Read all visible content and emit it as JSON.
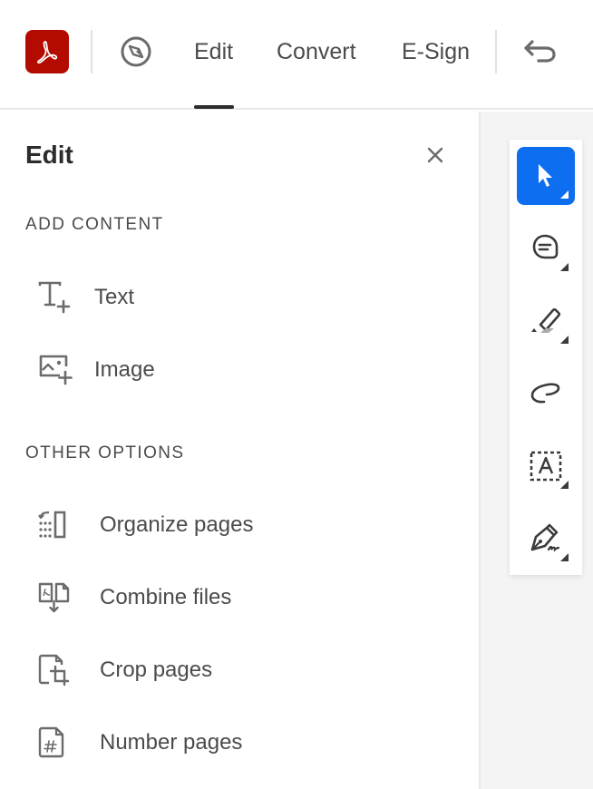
{
  "header": {
    "app_logo": "adobe-acrobat-logo",
    "nav_icon": "compass-icon",
    "tabs": [
      {
        "label": "Edit",
        "selected": true
      },
      {
        "label": "Convert",
        "selected": false
      },
      {
        "label": "E-Sign",
        "selected": false
      }
    ],
    "undo_icon": "undo-icon"
  },
  "panel": {
    "title": "Edit",
    "close_icon": "close-icon",
    "sections": [
      {
        "label": "ADD CONTENT",
        "items": [
          {
            "label": "Text",
            "icon": "add-text-icon"
          },
          {
            "label": "Image",
            "icon": "add-image-icon"
          }
        ]
      },
      {
        "label": "OTHER OPTIONS",
        "items": [
          {
            "label": "Organize pages",
            "icon": "organize-pages-icon"
          },
          {
            "label": "Combine files",
            "icon": "combine-files-icon"
          },
          {
            "label": "Crop pages",
            "icon": "crop-pages-icon"
          },
          {
            "label": "Number pages",
            "icon": "number-pages-icon"
          }
        ]
      }
    ]
  },
  "toolbar": {
    "tools": [
      {
        "name": "select",
        "icon": "cursor-icon",
        "active": true
      },
      {
        "name": "comment",
        "icon": "comment-icon",
        "active": false
      },
      {
        "name": "highlight",
        "icon": "highlighter-icon",
        "active": false
      },
      {
        "name": "draw",
        "icon": "freehand-draw-icon",
        "active": false
      },
      {
        "name": "text-select",
        "icon": "text-box-icon",
        "active": false
      },
      {
        "name": "sign",
        "icon": "pen-sign-icon",
        "active": false
      }
    ]
  },
  "colors": {
    "brand_red": "#b30b00",
    "active_blue": "#0d6ef0",
    "text_primary": "#2c2c2c",
    "text_secondary": "#4b4b4b"
  }
}
